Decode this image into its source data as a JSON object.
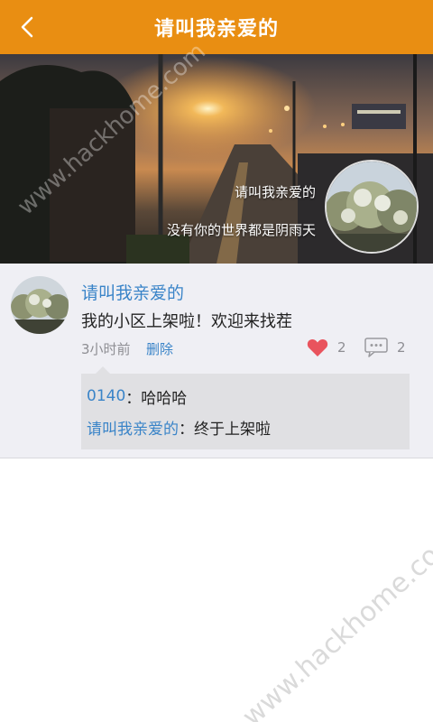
{
  "header": {
    "title": "请叫我亲爱的",
    "back_icon": "chevron-left-icon"
  },
  "cover": {
    "name": "请叫我亲爱的",
    "signature": "没有你的世界都是阴雨天"
  },
  "post": {
    "author": "请叫我亲爱的",
    "text": "我的小区上架啦！欢迎来找茬",
    "time": "3小时前",
    "delete_label": "删除",
    "likes": "2",
    "comments_count": "2",
    "like_icon": "heart-icon",
    "comment_icon": "comment-bubble-icon",
    "comments": [
      {
        "user": "0140",
        "sep": "：",
        "text": "哈哈哈"
      },
      {
        "user": "请叫我亲爱的",
        "sep": "：",
        "text": "终于上架啦"
      }
    ]
  },
  "watermark": "www.hackhome.com",
  "colors": {
    "header_bg": "#e98e12",
    "link_blue": "#3a84c8",
    "heart_red": "#e9535d",
    "panel_bg": "#efeff4"
  }
}
